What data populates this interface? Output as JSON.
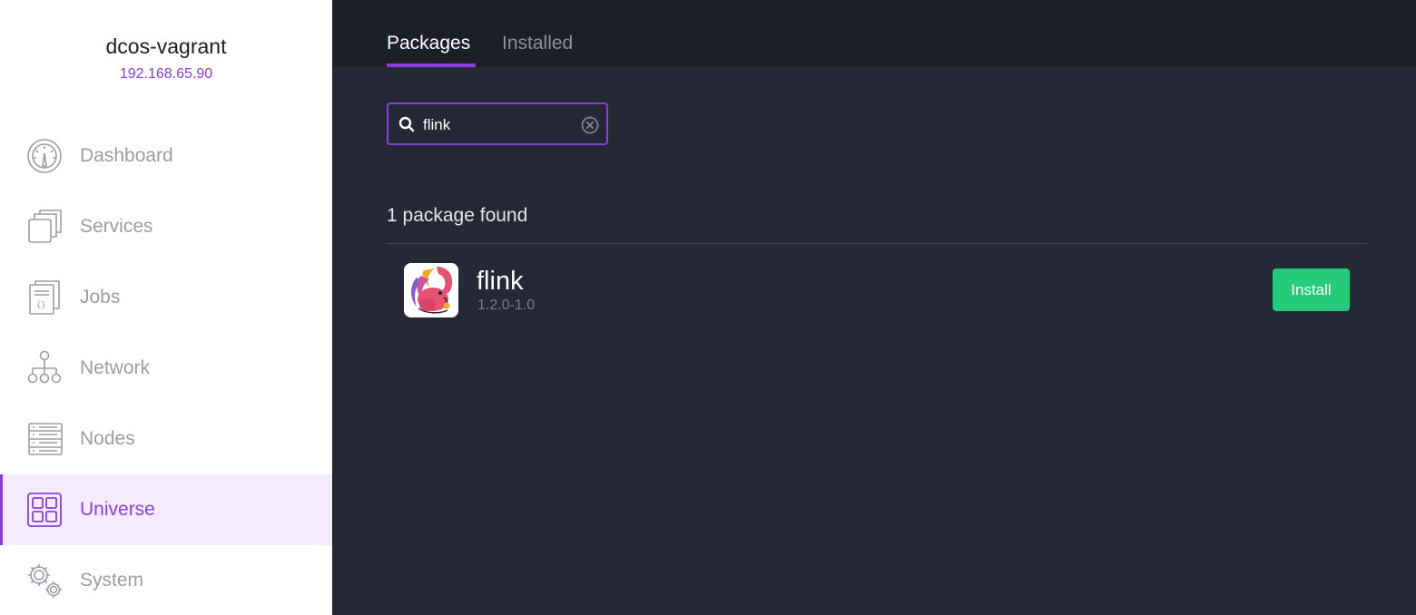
{
  "cluster": {
    "name": "dcos-vagrant",
    "ip": "192.168.65.90"
  },
  "sidebar": {
    "items": [
      {
        "label": "Dashboard",
        "icon": "dashboard-icon",
        "active": false
      },
      {
        "label": "Services",
        "icon": "services-icon",
        "active": false
      },
      {
        "label": "Jobs",
        "icon": "jobs-icon",
        "active": false
      },
      {
        "label": "Network",
        "icon": "network-icon",
        "active": false
      },
      {
        "label": "Nodes",
        "icon": "nodes-icon",
        "active": false
      },
      {
        "label": "Universe",
        "icon": "universe-icon",
        "active": true
      },
      {
        "label": "System",
        "icon": "system-gear-icon",
        "active": false
      }
    ]
  },
  "tabs": [
    {
      "label": "Packages",
      "active": true
    },
    {
      "label": "Installed",
      "active": false
    }
  ],
  "search": {
    "value": "flink",
    "icon": "search-icon",
    "clear_icon": "clear-circle-icon"
  },
  "results": {
    "count_text": "1 package found",
    "packages": [
      {
        "name": "flink",
        "version": "1.2.0-1.0",
        "logo": "flink-squirrel-logo",
        "action": "Install"
      }
    ]
  },
  "colors": {
    "accent": "#8a3fdb",
    "install": "#27c97b",
    "main_bg": "#252936",
    "topbar_bg": "#1c1f27",
    "active_nav_bg": "#f4ecfd"
  }
}
